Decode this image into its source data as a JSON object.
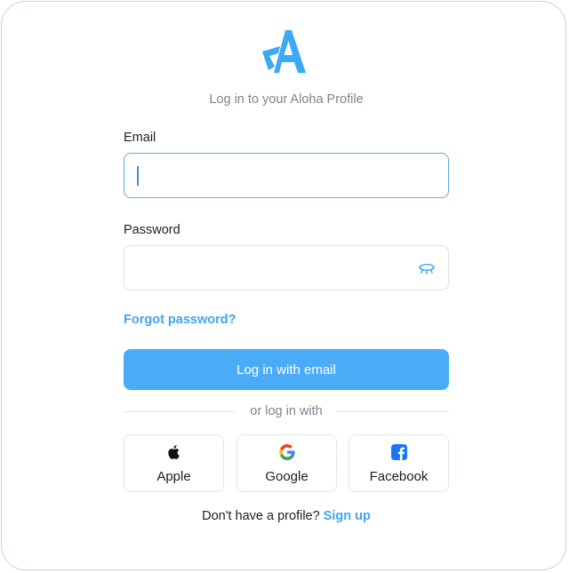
{
  "brand": {
    "logo_icon": "aloha-logo-icon",
    "accent_color": "#41a4f2"
  },
  "subtitle": "Log in to your Aloha Profile",
  "email": {
    "label": "Email",
    "value": "",
    "placeholder": ""
  },
  "password": {
    "label": "Password",
    "value": "",
    "placeholder": "",
    "toggle_icon": "eye-closed-icon"
  },
  "forgot_password": "Forgot password?",
  "login_button": "Log in with email",
  "divider": "or log in with",
  "social": [
    {
      "label": "Apple",
      "icon": "apple-icon"
    },
    {
      "label": "Google",
      "icon": "google-icon"
    },
    {
      "label": "Facebook",
      "icon": "facebook-icon"
    }
  ],
  "signup": {
    "prompt": "Don't have a profile?",
    "link": "Sign up"
  }
}
